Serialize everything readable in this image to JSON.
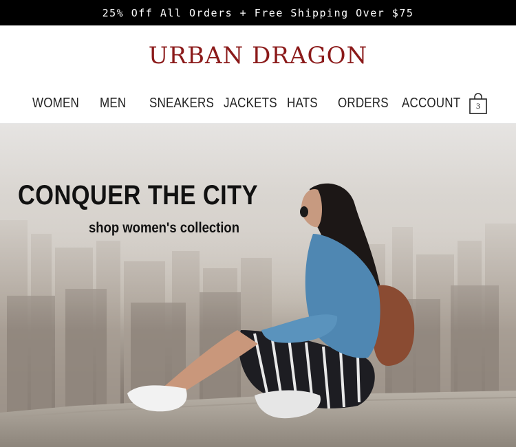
{
  "promo": {
    "text": "25% Off All Orders + Free Shipping Over $75"
  },
  "brand": {
    "name": "URBAN DRAGON",
    "color": "#8b1a1a"
  },
  "nav": {
    "items": [
      {
        "label": "WOMEN"
      },
      {
        "label": "MEN"
      },
      {
        "label": "SNEAKERS"
      },
      {
        "label": "JACKETS"
      },
      {
        "label": "HATS"
      },
      {
        "label": "ORDERS"
      },
      {
        "label": "ACCOUNT"
      }
    ],
    "cart": {
      "icon": "shopping-bag-icon",
      "count": "3"
    }
  },
  "hero": {
    "title": "CONQUER THE CITY",
    "cta": "shop women's collection"
  }
}
